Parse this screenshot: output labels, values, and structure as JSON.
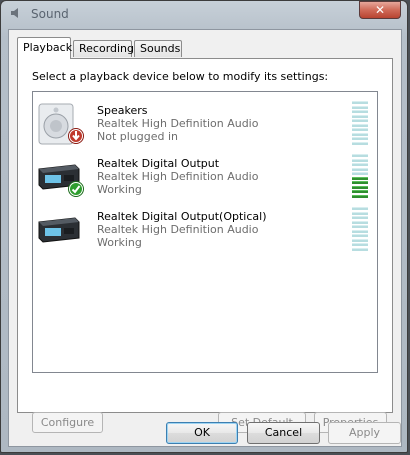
{
  "window": {
    "title": "Sound",
    "close_label": "✕"
  },
  "tabs": [
    {
      "label": "Playback",
      "active": true
    },
    {
      "label": "Recording",
      "active": false
    },
    {
      "label": "Sounds",
      "active": false
    }
  ],
  "playback": {
    "instructions": "Select a playback device below to modify its settings:",
    "devices": [
      {
        "name": "Speakers",
        "driver": "Realtek High Definition Audio",
        "status": "Not plugged in",
        "icon": "speaker-icon",
        "badge": "unplugged-arrow-icon",
        "level_segments_on": 0
      },
      {
        "name": "Realtek Digital Output",
        "driver": "Realtek High Definition Audio",
        "status": "Working",
        "icon": "digital-output-icon",
        "badge": "default-device-check-icon",
        "level_segments_on": 5
      },
      {
        "name": "Realtek Digital Output(Optical)",
        "driver": "Realtek High Definition Audio",
        "status": "Working",
        "icon": "optical-output-icon",
        "badge": "",
        "level_segments_on": 0
      }
    ],
    "buttons": {
      "configure": "Configure",
      "set_default": "Set Default",
      "properties": "Properties"
    }
  },
  "dialog_buttons": {
    "ok": "OK",
    "cancel": "Cancel",
    "apply": "Apply"
  },
  "colors": {
    "meter_off": "#b7dde0",
    "meter_on": "#2f8f2f",
    "badge_green": "#2e9e2e",
    "badge_red": "#c0392b"
  }
}
